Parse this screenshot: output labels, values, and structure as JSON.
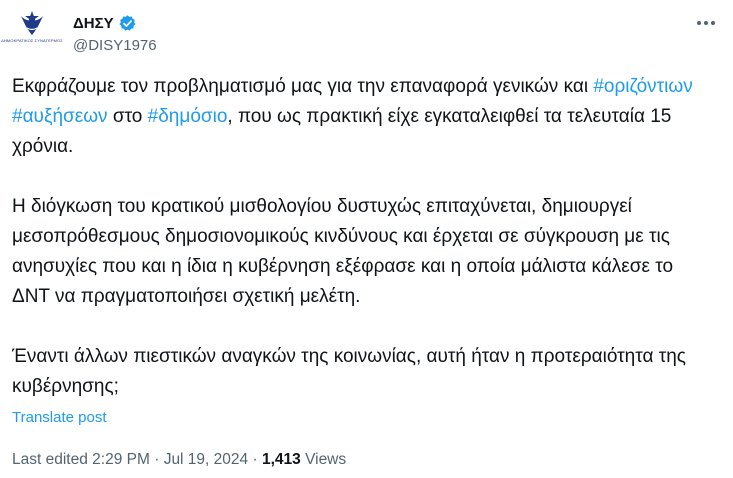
{
  "author": {
    "display_name": "ΔΗΣΥ",
    "handle": "@DISY1976",
    "avatar_caption": "ΔΗΜΟΚΡΑΤΙΚΟΣ ΣΥΝΑΓΕΡΜΟΣ",
    "verified": true
  },
  "tweet": {
    "paragraphs": [
      {
        "segments": [
          {
            "text": "Εκφράζουμε τον προβληματισμό μας για την επαναφορά γενικών και ",
            "hashtag": false
          },
          {
            "text": "#οριζόντιων",
            "hashtag": true
          },
          {
            "text": " ",
            "hashtag": false
          },
          {
            "text": "#αυξήσεων",
            "hashtag": true
          },
          {
            "text": " στο ",
            "hashtag": false
          },
          {
            "text": "#δημόσιο",
            "hashtag": true
          },
          {
            "text": ", που ως πρακτική είχε εγκαταλειφθεί τα τελευταία 15 χρόνια.",
            "hashtag": false
          }
        ]
      },
      {
        "segments": [
          {
            "text": "Η διόγκωση του κρατικού μισθολογίου δυστυχώς επιταχύνεται, δημιουργεί μεσοπρόθεσμους δημοσιονομικούς κινδύνους και έρχεται σε σύγκρουση με τις ανησυχίες που και η ίδια η κυβέρνηση εξέφρασε και η οποία μάλιστα κάλεσε το ΔΝΤ να πραγματοποιήσει σχετική μελέτη.",
            "hashtag": false
          }
        ]
      },
      {
        "segments": [
          {
            "text": "Έναντι άλλων πιεστικών αναγκών της κοινωνίας, αυτή ήταν η προτεραιότητα της κυβέρνησης;",
            "hashtag": false
          }
        ]
      }
    ]
  },
  "actions": {
    "translate_label": "Translate post",
    "more_icon": "more-horizontal-icon"
  },
  "meta": {
    "edited_label": "Last edited",
    "time": "2:29 PM",
    "separator": "·",
    "date": "Jul 19, 2024",
    "views_count": "1,413",
    "views_label": "Views"
  },
  "colors": {
    "accent": "#1d9bf0",
    "text_primary": "#0f1419",
    "text_secondary": "#536471"
  }
}
